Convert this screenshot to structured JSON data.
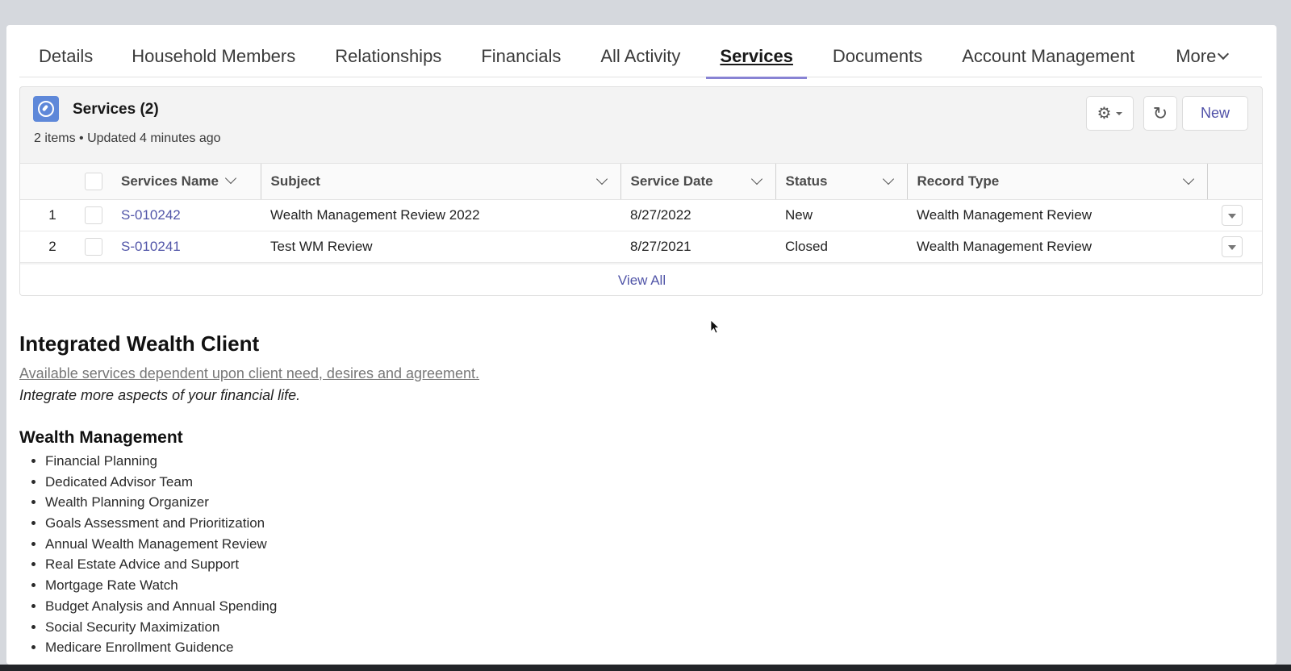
{
  "tabs": [
    {
      "label": "Details",
      "active": false
    },
    {
      "label": "Household Members",
      "active": false
    },
    {
      "label": "Relationships",
      "active": false
    },
    {
      "label": "Financials",
      "active": false
    },
    {
      "label": "All Activity",
      "active": false
    },
    {
      "label": "Services",
      "active": true
    },
    {
      "label": "Documents",
      "active": false
    },
    {
      "label": "Account Management",
      "active": false
    },
    {
      "label": "More",
      "active": false
    }
  ],
  "related_list": {
    "icon": "service-compass-icon",
    "title": "Services (2)",
    "subtitle": "2 items • Updated 4 minutes ago",
    "actions": {
      "settings_icon": "gear-icon",
      "refresh_icon": "refresh-icon",
      "new_label": "New"
    },
    "columns": [
      "Services Name",
      "Subject",
      "Service Date",
      "Status",
      "Record Type"
    ],
    "rows": [
      {
        "num": "1",
        "name": "S-010242",
        "subject": "Wealth Management Review 2022",
        "date": "8/27/2022",
        "status": "New",
        "record_type": "Wealth Management Review"
      },
      {
        "num": "2",
        "name": "S-010241",
        "subject": "Test WM Review",
        "date": "8/27/2021",
        "status": "Closed",
        "record_type": "Wealth Management Review"
      }
    ],
    "view_all": "View All"
  },
  "content": {
    "title": "Integrated Wealth Client",
    "link_text": "Available services dependent upon client need, desires and agreement.",
    "tagline": "Integrate more aspects of your financial life.",
    "section_title": "Wealth Management",
    "items": [
      "Financial Planning",
      "Dedicated Advisor Team",
      "Wealth Planning Organizer",
      "Goals Assessment and Prioritization",
      "Annual Wealth Management Review",
      "Real Estate Advice and Support",
      "Mortgage Rate Watch",
      "Budget Analysis and Annual Spending",
      "Social Security Maximization",
      "Medicare Enrollment Guidence"
    ]
  },
  "colors": {
    "accent": "#8883d4",
    "link": "#5155a8",
    "icon_bg": "#5e88d9"
  }
}
